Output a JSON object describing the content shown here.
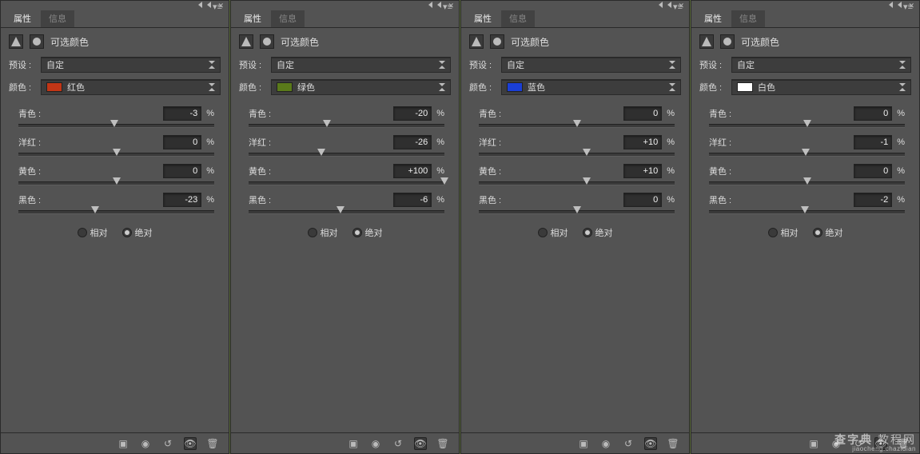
{
  "common": {
    "tab_properties": "属性",
    "tab_info": "信息",
    "panel_title": "可选颜色",
    "preset_label": "预设 :",
    "preset_value": "自定",
    "color_label": "颜色 :",
    "cyan_label": "青色 :",
    "magenta_label": "洋红 :",
    "yellow_label": "黄色 :",
    "black_label": "黑色 :",
    "pct": "%",
    "radio_relative": "相对",
    "radio_absolute": "绝对"
  },
  "panels": [
    {
      "swatch": "#c23616",
      "color_name": "红色",
      "cyan": "-3",
      "magenta": "0",
      "yellow": "0",
      "black": "-23"
    },
    {
      "swatch": "#5a7a1a",
      "color_name": "绿色",
      "cyan": "-20",
      "magenta": "-26",
      "yellow": "+100",
      "black": "-6"
    },
    {
      "swatch": "#1a3fd6",
      "color_name": "蓝色",
      "cyan": "0",
      "magenta": "+10",
      "yellow": "+10",
      "black": "0"
    },
    {
      "swatch": "#ffffff",
      "color_name": "白色",
      "cyan": "0",
      "magenta": "-1",
      "yellow": "0",
      "black": "-2"
    }
  ],
  "watermark": {
    "line1": "查字典",
    "line2": "jiaocheng.chazidian"
  }
}
